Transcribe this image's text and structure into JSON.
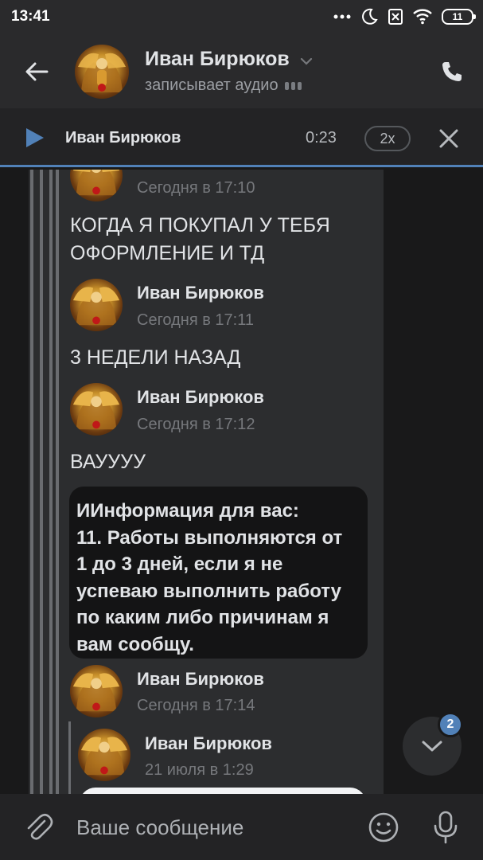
{
  "status_bar": {
    "time": "13:41",
    "battery": "11",
    "icons": [
      "more-dots-icon",
      "moon-icon",
      "no-sim-icon",
      "wifi-icon",
      "battery-icon"
    ]
  },
  "header": {
    "contact_name": "Иван Бирюков",
    "status": "записывает аудио",
    "icons": [
      "back-arrow-icon",
      "chevron-down-icon",
      "phone-icon"
    ]
  },
  "player": {
    "track_name": "Иван Бирюков",
    "elapsed": "0:23",
    "speed": "2x",
    "icons": [
      "play-icon",
      "close-icon"
    ]
  },
  "messages": [
    {
      "author": "",
      "time": "Сегодня в 17:10",
      "text": "КОГДА Я ПОКУПАЛ У ТЕБЯ ОФОРМЛЕНИЕ И ТД"
    },
    {
      "author": "Иван Бирюков",
      "time": "Сегодня в 17:11",
      "text": "3 НЕДЕЛИ НАЗАД"
    },
    {
      "author": "Иван Бирюков",
      "time": "Сегодня в 17:12",
      "text": "ВАУУУУ"
    }
  ],
  "info_message": {
    "lines": [
      "ИИнформация для вас:",
      "11. Работы выполняются от",
      "1 до 3 дней, если я не",
      "успеваю выполнить работу",
      "по каким либо причинам я",
      "вам сообщу."
    ]
  },
  "sender_after_info": {
    "author": "Иван Бирюков",
    "time": "Сегодня в 17:14"
  },
  "nested_forward": {
    "author": "Иван Бирюков",
    "time": "21 июля в 1:29"
  },
  "scroll_down": {
    "badge": "2",
    "icon": "chevron-down-icon"
  },
  "composer": {
    "placeholder": "Ваше сообщение",
    "icons": [
      "paperclip-icon",
      "emoji-icon",
      "microphone-icon"
    ]
  },
  "colors": {
    "accent": "#5181b8",
    "background": "#19191a",
    "panel": "#2c2d2f",
    "header": "#2a2a2c"
  }
}
